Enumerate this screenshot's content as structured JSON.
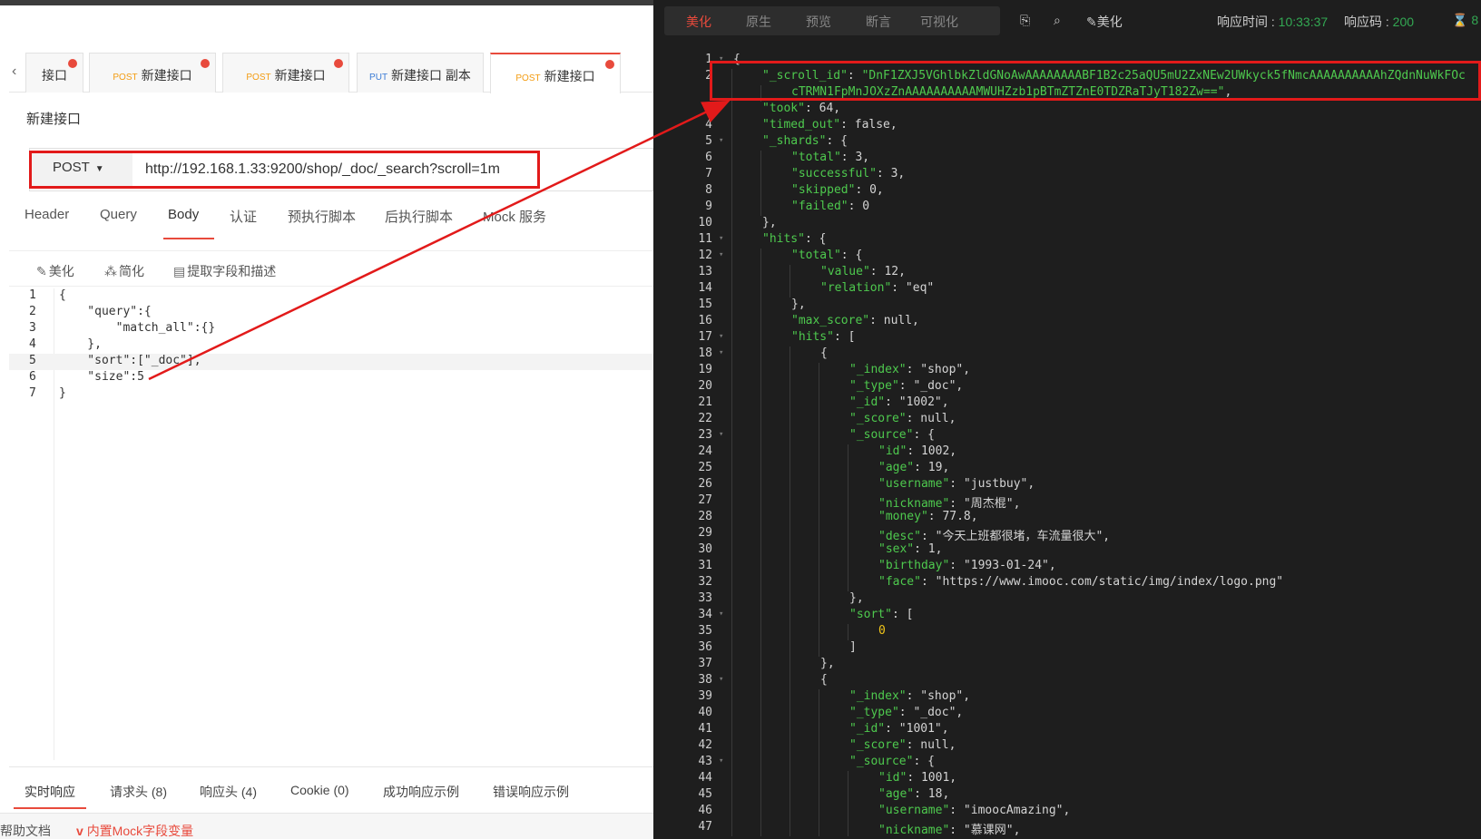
{
  "left": {
    "tabs": [
      {
        "method": "",
        "label": "接口"
      },
      {
        "method": "POST",
        "label": "新建接口"
      },
      {
        "method": "POST",
        "label": "新建接口"
      },
      {
        "method": "PUT",
        "label": "新建接口 副本"
      },
      {
        "method": "POST",
        "label": "新建接口"
      }
    ],
    "page_title": "新建接口",
    "request": {
      "method": "POST",
      "url": "http://192.168.1.33:9200/shop/_doc/_search?scroll=1m"
    },
    "sub_tabs": [
      "Header",
      "Query",
      "Body",
      "认证",
      "预执行脚本",
      "后执行脚本",
      "Mock 服务"
    ],
    "active_sub_tab": "Body",
    "body_tools": [
      "美化",
      "简化",
      "提取字段和描述"
    ],
    "body_lines": [
      {
        "ln": "1",
        "text": "{"
      },
      {
        "ln": "2",
        "text": "    \"query\":{"
      },
      {
        "ln": "3",
        "text": "        \"match_all\":{}"
      },
      {
        "ln": "4",
        "text": "    },"
      },
      {
        "ln": "5",
        "text": "    \"sort\":[\"_doc\"],"
      },
      {
        "ln": "6",
        "text": "    \"size\":5"
      },
      {
        "ln": "7",
        "text": "}"
      }
    ],
    "response_tabs": [
      "实时响应",
      "请求头 (8)",
      "响应头 (4)",
      "Cookie (0)",
      "成功响应示例",
      "错误响应示例"
    ],
    "footer": {
      "help": "帮助文档",
      "mock": "内置Mock字段变量"
    }
  },
  "right": {
    "tabs": [
      "美化",
      "原生",
      "预览",
      "断言",
      "可视化"
    ],
    "active_tab": "美化",
    "tool_beautify": "美化",
    "resp_time_label": "响应时间 :",
    "resp_time": "10:33:37",
    "resp_code_label": "响应码 :",
    "resp_code": "200",
    "resp_size": "8",
    "json_lines": [
      {
        "ln": "1",
        "i": 0,
        "t": "{"
      },
      {
        "ln": "2",
        "i": 1,
        "t": "\"_scroll_id\": \"DnF1ZXJ5VGhlbkZldGNoAwAAAAAAAABF1B2c25aQU5mU2ZxNEw2UWkyck5fNmcAAAAAAAAAAhZQdnNuWkFOc"
      },
      {
        "ln": "",
        "i": 2,
        "t": "cTRMN1FpMnJOXzZnAAAAAAAAAAMWUHZzb1pBTmZTZnE0TDZRaTJyT182Zw==\","
      },
      {
        "ln": "3",
        "i": 1,
        "t": "\"took\": 64,"
      },
      {
        "ln": "4",
        "i": 1,
        "t": "\"timed_out\": false,"
      },
      {
        "ln": "5",
        "i": 1,
        "t": "\"_shards\": {"
      },
      {
        "ln": "6",
        "i": 2,
        "t": "\"total\": 3,"
      },
      {
        "ln": "7",
        "i": 2,
        "t": "\"successful\": 3,"
      },
      {
        "ln": "8",
        "i": 2,
        "t": "\"skipped\": 0,"
      },
      {
        "ln": "9",
        "i": 2,
        "t": "\"failed\": 0"
      },
      {
        "ln": "10",
        "i": 1,
        "t": "},"
      },
      {
        "ln": "11",
        "i": 1,
        "t": "\"hits\": {"
      },
      {
        "ln": "12",
        "i": 2,
        "t": "\"total\": {"
      },
      {
        "ln": "13",
        "i": 3,
        "t": "\"value\": 12,"
      },
      {
        "ln": "14",
        "i": 3,
        "t": "\"relation\": \"eq\""
      },
      {
        "ln": "15",
        "i": 2,
        "t": "},"
      },
      {
        "ln": "16",
        "i": 2,
        "t": "\"max_score\": null,"
      },
      {
        "ln": "17",
        "i": 2,
        "t": "\"hits\": ["
      },
      {
        "ln": "18",
        "i": 3,
        "t": "{"
      },
      {
        "ln": "19",
        "i": 4,
        "t": "\"_index\": \"shop\","
      },
      {
        "ln": "20",
        "i": 4,
        "t": "\"_type\": \"_doc\","
      },
      {
        "ln": "21",
        "i": 4,
        "t": "\"_id\": \"1002\","
      },
      {
        "ln": "22",
        "i": 4,
        "t": "\"_score\": null,"
      },
      {
        "ln": "23",
        "i": 4,
        "t": "\"_source\": {"
      },
      {
        "ln": "24",
        "i": 5,
        "t": "\"id\": 1002,"
      },
      {
        "ln": "25",
        "i": 5,
        "t": "\"age\": 19,"
      },
      {
        "ln": "26",
        "i": 5,
        "t": "\"username\": \"justbuy\","
      },
      {
        "ln": "27",
        "i": 5,
        "t": "\"nickname\": \"周杰棍\","
      },
      {
        "ln": "28",
        "i": 5,
        "t": "\"money\": 77.8,"
      },
      {
        "ln": "29",
        "i": 5,
        "t": "\"desc\": \"今天上班都很堵，车流量很大\","
      },
      {
        "ln": "30",
        "i": 5,
        "t": "\"sex\": 1,"
      },
      {
        "ln": "31",
        "i": 5,
        "t": "\"birthday\": \"1993-01-24\","
      },
      {
        "ln": "32",
        "i": 5,
        "t": "\"face\": \"https://www.imooc.com/static/img/index/logo.png\""
      },
      {
        "ln": "33",
        "i": 4,
        "t": "},"
      },
      {
        "ln": "34",
        "i": 4,
        "t": "\"sort\": ["
      },
      {
        "ln": "35",
        "i": 5,
        "t": "0"
      },
      {
        "ln": "36",
        "i": 4,
        "t": "]"
      },
      {
        "ln": "37",
        "i": 3,
        "t": "},"
      },
      {
        "ln": "38",
        "i": 3,
        "t": "{"
      },
      {
        "ln": "39",
        "i": 4,
        "t": "\"_index\": \"shop\","
      },
      {
        "ln": "40",
        "i": 4,
        "t": "\"_type\": \"_doc\","
      },
      {
        "ln": "41",
        "i": 4,
        "t": "\"_id\": \"1001\","
      },
      {
        "ln": "42",
        "i": 4,
        "t": "\"_score\": null,"
      },
      {
        "ln": "43",
        "i": 4,
        "t": "\"_source\": {"
      },
      {
        "ln": "44",
        "i": 5,
        "t": "\"id\": 1001,"
      },
      {
        "ln": "45",
        "i": 5,
        "t": "\"age\": 18,"
      },
      {
        "ln": "46",
        "i": 5,
        "t": "\"username\": \"imoocAmazing\","
      },
      {
        "ln": "47",
        "i": 5,
        "t": "\"nickname\": \"慕课网\","
      }
    ]
  },
  "colors": {
    "accent": "#e84a3c",
    "highlight_box": "#e21a1a",
    "json_key": "#4ec94e",
    "json_number": "#f0c419"
  }
}
